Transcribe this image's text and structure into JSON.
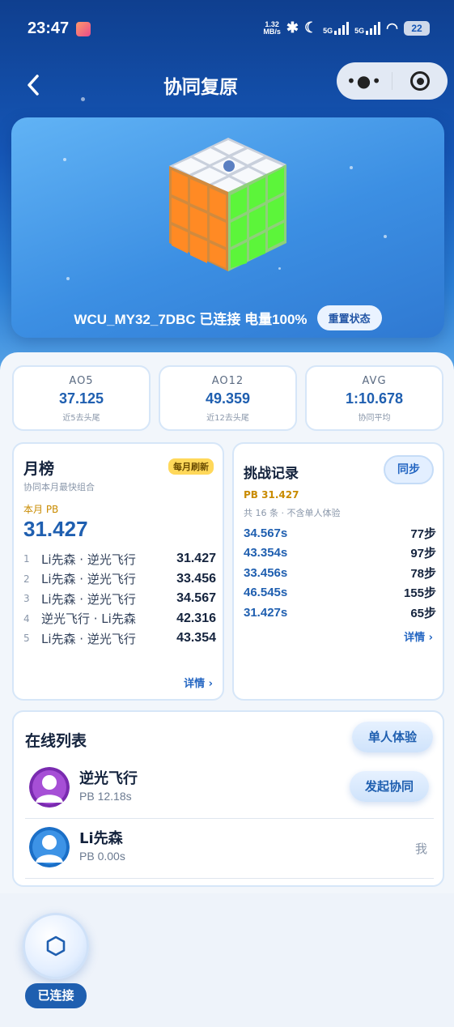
{
  "status_bar": {
    "time": "23:47",
    "net_rate_value": "1.32",
    "net_rate_unit": "MB/s",
    "signal1": "5G",
    "signal2": "5G",
    "battery": "22"
  },
  "nav": {
    "back_icon": "chevron-left-icon",
    "title": "协同复原"
  },
  "hero": {
    "device_status": "WCU_MY32_7DBC 已连接 电量100%",
    "reset_button": "重置状态",
    "colors": {
      "top": "#f5f7fb",
      "left": "#ff8a24",
      "right": "#5cf53a"
    }
  },
  "stats": [
    {
      "label": "AO5",
      "value": "37.125",
      "sub": "近5去头尾"
    },
    {
      "label": "AO12",
      "value": "49.359",
      "sub": "近12去头尾"
    },
    {
      "label": "AVG",
      "value": "1:10.678",
      "sub": "协同平均"
    }
  ],
  "monthly": {
    "title": "月榜",
    "badge": "每月刷新",
    "desc": "协同本月最快组合",
    "pb_label": "本月 PB",
    "pb_value": "31.427",
    "rows": [
      {
        "rank": "1",
        "names": "Li先森 · 逆光飞行",
        "time": "31.427"
      },
      {
        "rank": "2",
        "names": "Li先森 · 逆光飞行",
        "time": "33.456"
      },
      {
        "rank": "3",
        "names": "Li先森 · 逆光飞行",
        "time": "34.567"
      },
      {
        "rank": "4",
        "names": "逆光飞行 · Li先森",
        "time": "42.316"
      },
      {
        "rank": "5",
        "names": "Li先森 · 逆光飞行",
        "time": "43.354"
      }
    ],
    "detail": "详情 ›"
  },
  "challenge": {
    "title": "挑战记录",
    "sync_button": "同步",
    "pb": "PB 31.427",
    "count": "共 16 条 · 不含单人体验",
    "records": [
      {
        "time": "34.567s",
        "steps": "77步"
      },
      {
        "time": "43.354s",
        "steps": "97步"
      },
      {
        "time": "33.456s",
        "steps": "78步"
      },
      {
        "time": "46.545s",
        "steps": "155步"
      },
      {
        "time": "31.427s",
        "steps": "65步"
      }
    ],
    "detail": "详情 ›"
  },
  "online": {
    "title": "在线列表",
    "solo_button": "单人体验",
    "users": [
      {
        "name": "逆光飞行",
        "pb": "PB 12.18s",
        "action": "发起协同"
      },
      {
        "name": "Li先森",
        "pb": "PB 0.00s",
        "tag": "我"
      }
    ]
  },
  "bottom": {
    "connection_icon": "hexagon-icon",
    "connection_label": "已连接"
  }
}
